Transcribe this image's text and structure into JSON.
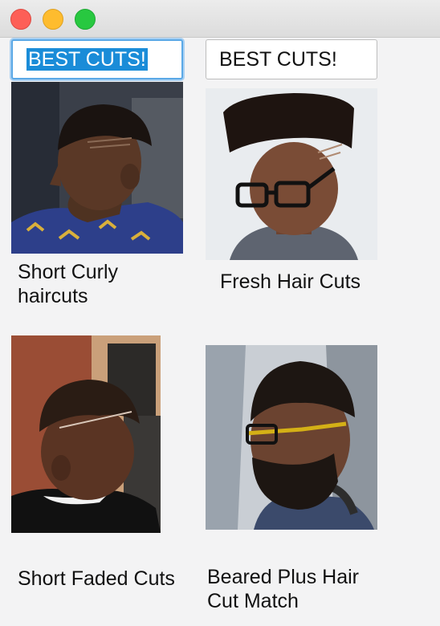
{
  "window": {
    "controls": [
      "close-button",
      "minimize-button",
      "zoom-button"
    ]
  },
  "fields": [
    {
      "value": "BEST CUTS!",
      "state": "focused-selected"
    },
    {
      "value": "BEST CUTS!",
      "state": "normal"
    }
  ],
  "gallery": [
    {
      "caption_line1": "Short Curly",
      "caption_line2": "haircuts",
      "image": "short-curly-haircut-photo"
    },
    {
      "caption_line1": "Fresh Hair Cuts",
      "caption_line2": "",
      "image": "flat-top-haircut-photo"
    },
    {
      "caption_line1": "Short Faded Cuts",
      "caption_line2": "",
      "image": "short-faded-haircut-photo"
    },
    {
      "caption_line1": "Beared Plus Hair",
      "caption_line2": "Cut Match",
      "image": "beard-fade-haircut-photo"
    }
  ],
  "colors": {
    "selection": "#1a8cd8",
    "focus_ring": "#5aa8e6",
    "background": "#f3f3f4"
  }
}
